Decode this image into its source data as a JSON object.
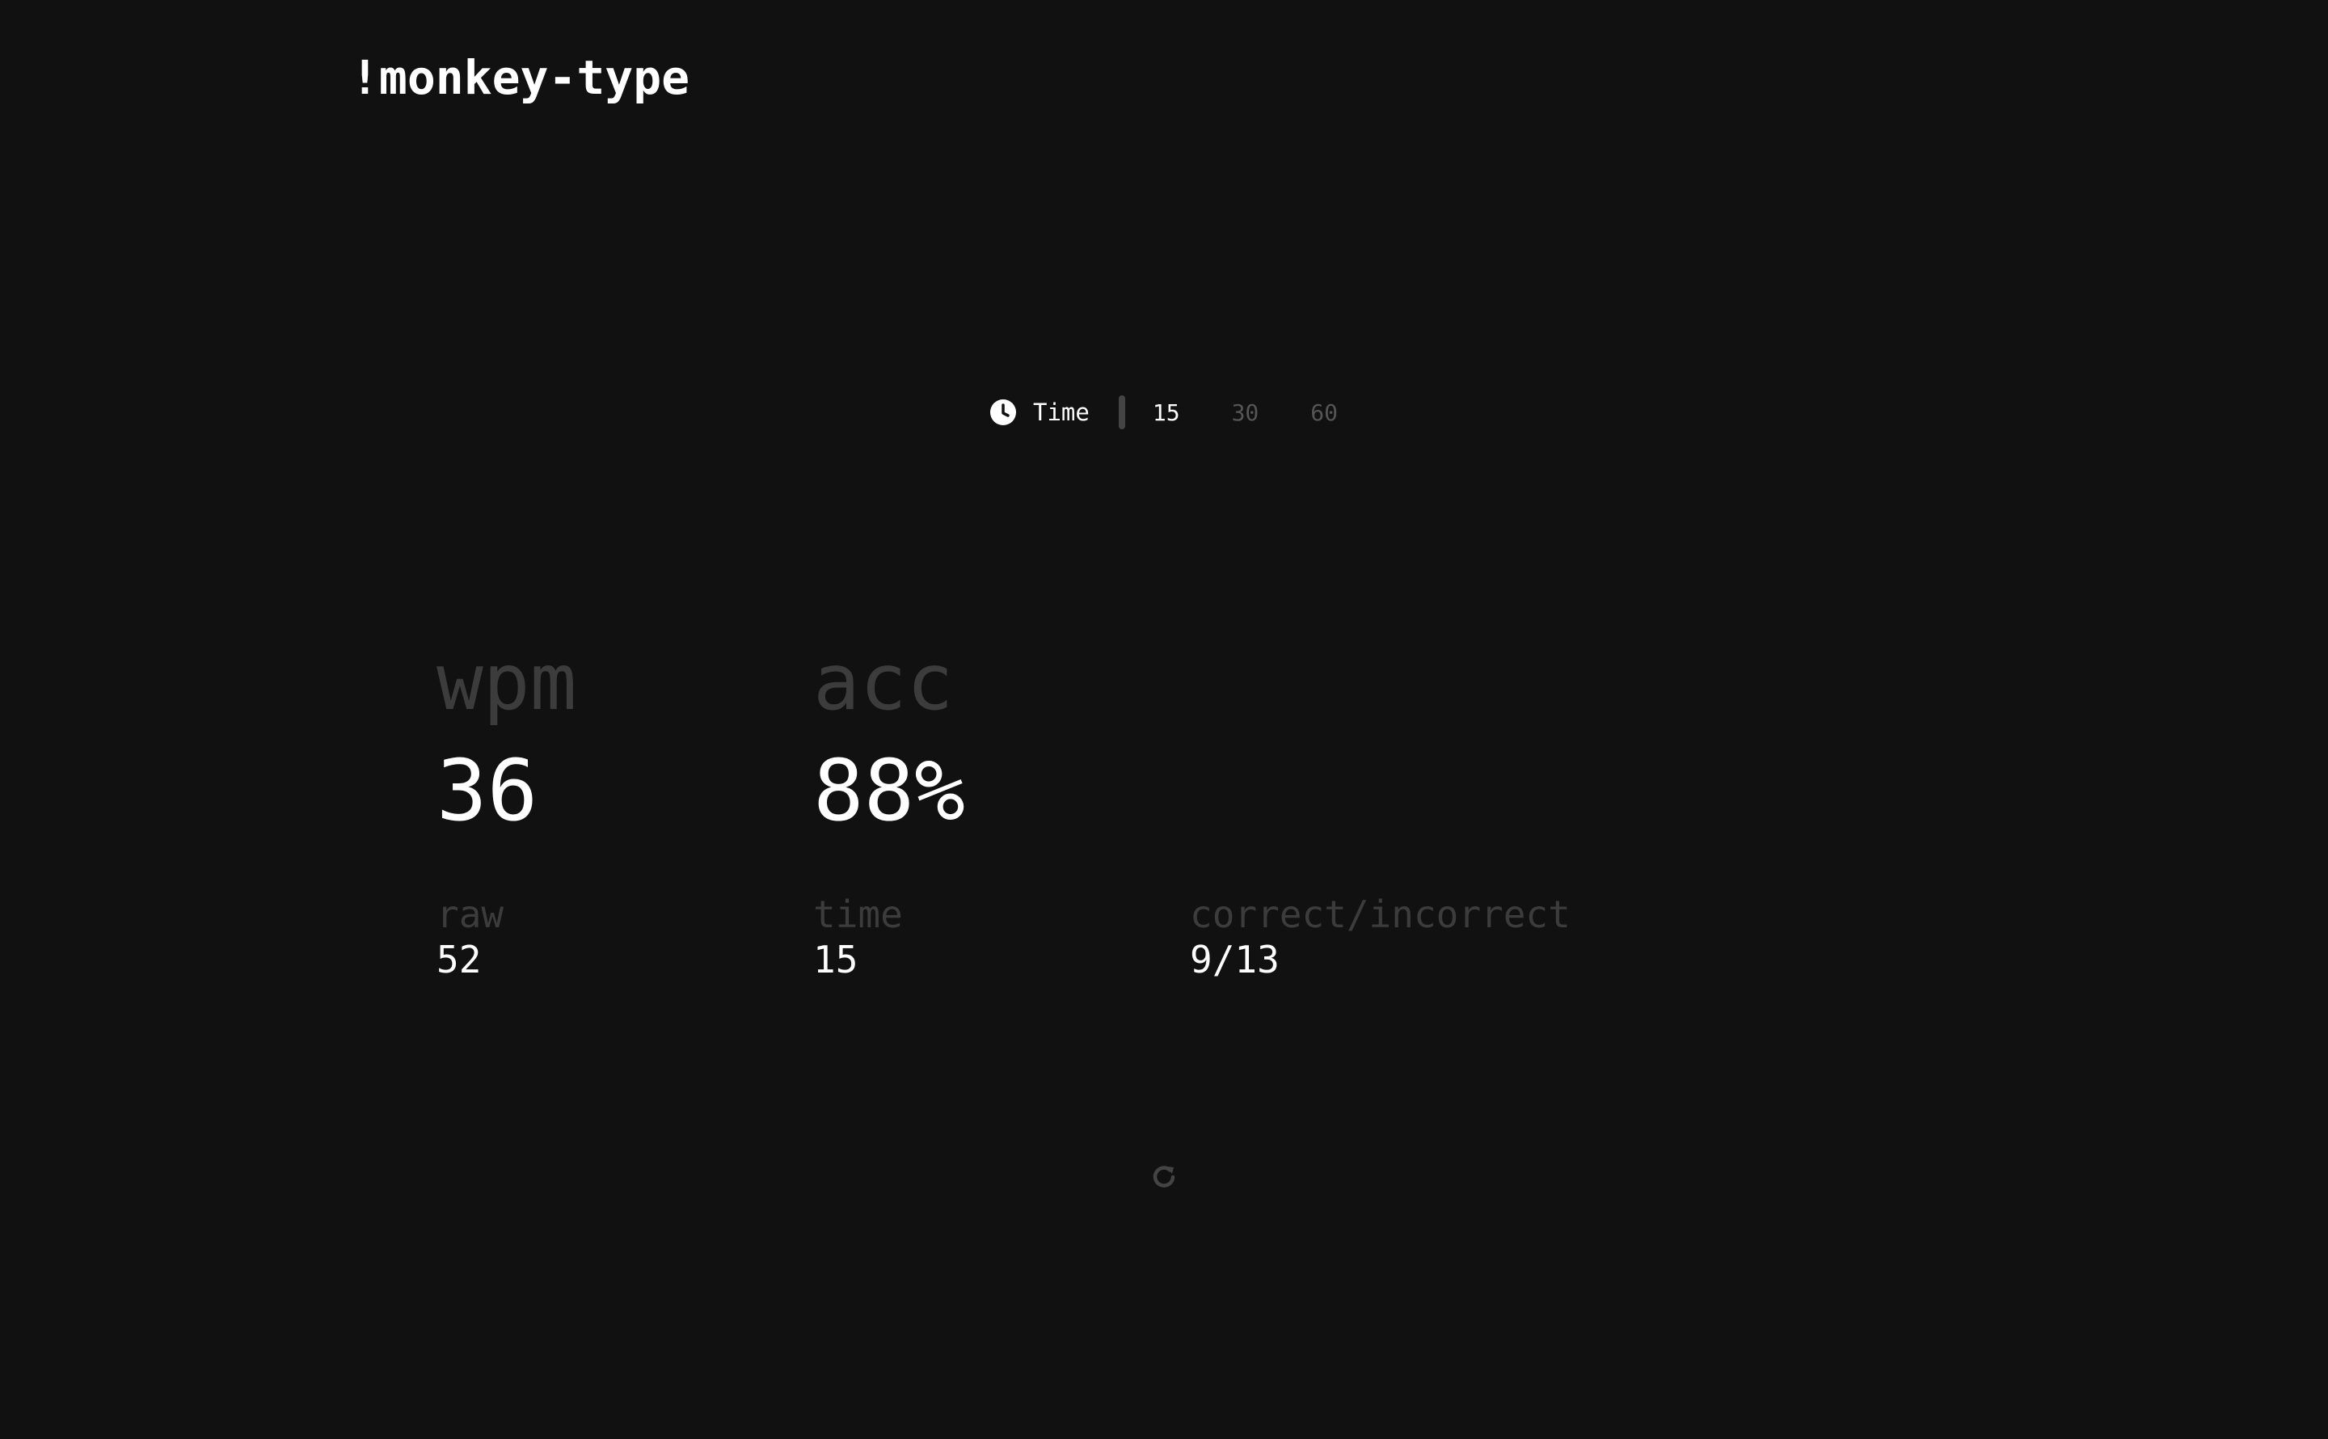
{
  "app": {
    "logo": "!monkey-type"
  },
  "mode": {
    "label": "Time",
    "icon": "clock-icon",
    "durations": [
      "15",
      "30",
      "60"
    ],
    "selected": "15"
  },
  "results": {
    "wpm_label": "wpm",
    "wpm_value": "36",
    "acc_label": "acc",
    "acc_value": "88%",
    "raw_label": "raw",
    "raw_value": "52",
    "time_label": "time",
    "time_value": "15",
    "chars_label": "correct/incorrect",
    "chars_value": "9/13"
  },
  "actions": {
    "restart_icon": "restart-icon"
  },
  "colors": {
    "background": "#111111",
    "text": "#ffffff",
    "muted": "#3c3c3c",
    "inactive": "#555555"
  }
}
